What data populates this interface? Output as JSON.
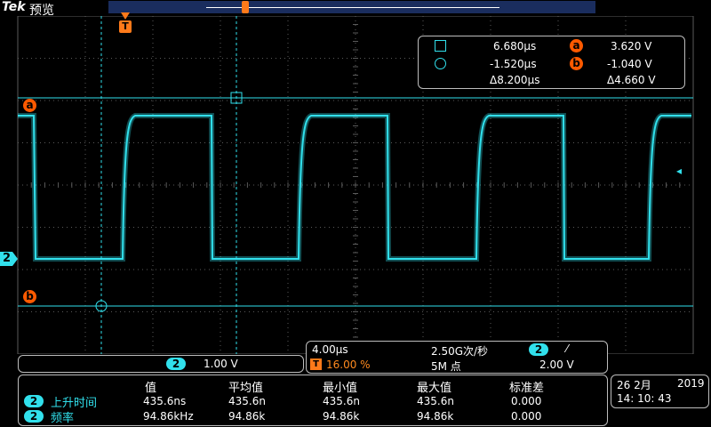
{
  "header": {
    "brand": "Tek",
    "mode": "预览"
  },
  "markers": {
    "trigger": "T",
    "cursor_a": "a",
    "cursor_b": "b",
    "channel": "2"
  },
  "cursor_readout": {
    "row1": {
      "time": "6.680µs",
      "badge": "a",
      "volt": "3.620 V"
    },
    "row2": {
      "time": "-1.520µs",
      "badge": "b",
      "volt": "-1.040 V"
    },
    "row3": {
      "dtime": "Δ8.200µs",
      "dvolt": "Δ4.660 V"
    }
  },
  "channel_panel": {
    "channel": "2",
    "scale": "1.00 V"
  },
  "acq_panel": {
    "timebase": "4.00µs",
    "sample_rate": "2.50G次/秒",
    "channel": "2",
    "slope": "⁄",
    "trigger_icon": "T",
    "trigger_pos": "16.00 %",
    "record_length": "5M 点",
    "trigger_level": "2.00 V"
  },
  "measurements": {
    "headers": [
      "值",
      "平均值",
      "最小值",
      "最大值",
      "标准差"
    ],
    "rows": [
      {
        "channel": "2",
        "name": "上升时间",
        "value": "435.6ns",
        "mean": "435.6n",
        "min": "435.6n",
        "max": "435.6n",
        "std": "0.000"
      },
      {
        "channel": "2",
        "name": "频率",
        "value": "94.86kHz",
        "mean": "94.86k",
        "min": "94.86k",
        "max": "94.86k",
        "std": "0.000"
      }
    ]
  },
  "datetime": {
    "date": "26 2月",
    "year": "2019",
    "time": "14: 10: 43"
  },
  "colors": {
    "trace": "#31e0ec",
    "cursor": "#31e0ec",
    "accent": "#ff6a00"
  }
}
